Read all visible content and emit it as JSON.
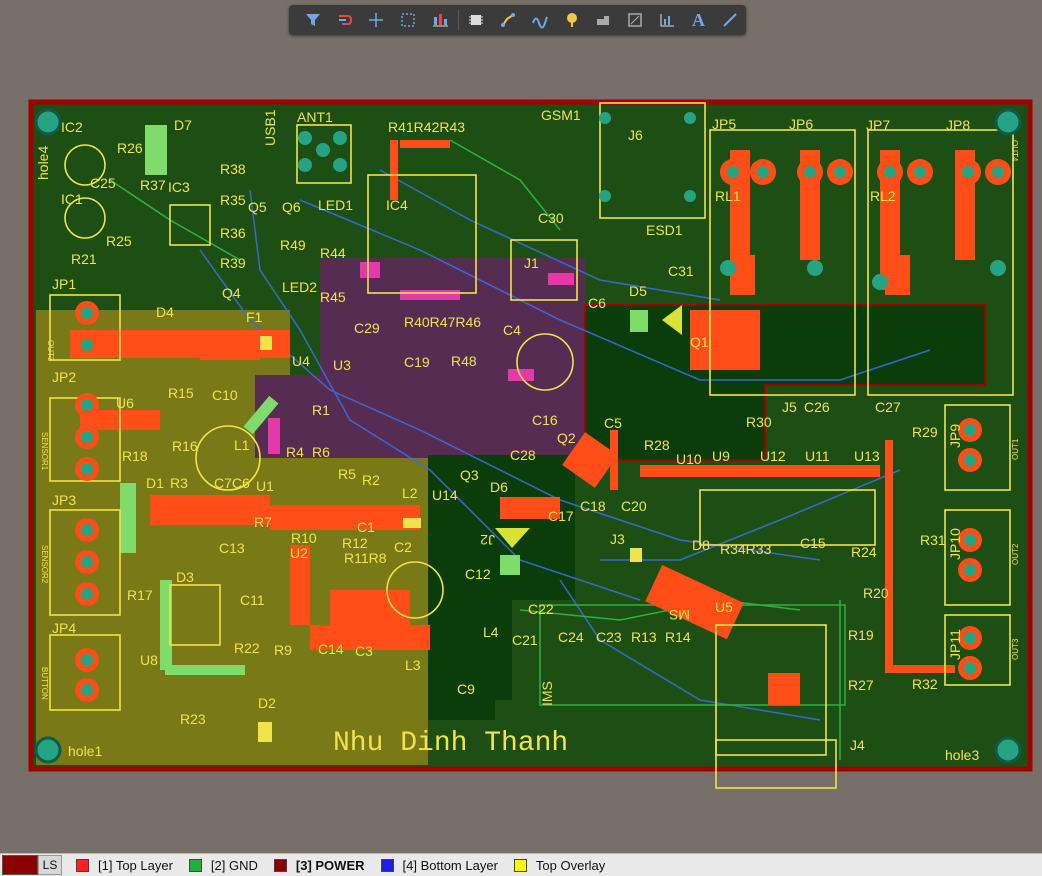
{
  "toolbar": {
    "icons": [
      "filter-icon",
      "route-icon",
      "crosshair-icon",
      "select-rect-icon",
      "align-icon",
      "component-icon",
      "interactive-route-icon",
      "diff-pair-icon",
      "via-icon",
      "polygon-icon",
      "region-icon",
      "dimension-icon",
      "text-icon",
      "line-icon"
    ],
    "text_tool_label": "A"
  },
  "board": {
    "signature": "Nhu Dinh Thanh",
    "holes": [
      "hole1",
      "hole3",
      "hole4"
    ],
    "components": [
      "IC2",
      "R26",
      "C25",
      "R37",
      "IC3",
      "IC1",
      "R25",
      "R21",
      "D7",
      "R38",
      "R35",
      "R36",
      "R39",
      "Q4",
      "USB1",
      "Q5",
      "Q6",
      "R49",
      "ANT1",
      "LED1",
      "IC4",
      "R41",
      "R42",
      "R43",
      "GSM1",
      "J6",
      "C30",
      "ESD1",
      "C31",
      "J1",
      "R44",
      "R45",
      "LED2",
      "C29",
      "R40",
      "R47",
      "R46",
      "C19",
      "R48",
      "C4",
      "F1",
      "D4",
      "U4",
      "U3",
      "R1",
      "JP1",
      "JP2",
      "JP3",
      "JP4",
      "U6",
      "R15",
      "C10",
      "R16",
      "L1",
      "R18",
      "D1",
      "R3",
      "C7",
      "C6",
      "U1",
      "R4",
      "R6",
      "R5",
      "R2",
      "L2",
      "C1",
      "R7",
      "R10",
      "R12",
      "R11",
      "R8",
      "C2",
      "U2",
      "C13",
      "D3",
      "R17",
      "C11",
      "R22",
      "U8",
      "R9",
      "C14",
      "C3",
      "L3",
      "C9",
      "R23",
      "D2",
      "Q1",
      "D5",
      "C5",
      "Q2",
      "C16",
      "Q3",
      "C28",
      "D6",
      "U14",
      "J2",
      "C18",
      "C17",
      "C20",
      "J3",
      "C12",
      "R28",
      "U10",
      "U9",
      "U12",
      "U11",
      "U13",
      "R30",
      "J5",
      "C26",
      "C27",
      "R29",
      "R31",
      "R24",
      "R20",
      "R19",
      "R27",
      "J4",
      "R32",
      "D8",
      "R34",
      "R33",
      "C15",
      "U5",
      "MS",
      "C22",
      "C21",
      "C24",
      "C23",
      "R13",
      "R14",
      "L4",
      "JP5",
      "JP6",
      "JP7",
      "JP8",
      "RL1",
      "RL2",
      "JP9",
      "JP10",
      "JP11"
    ],
    "connector_labels": [
      "OUT3",
      "SENSOR1",
      "SENSOR2",
      "BUTTON",
      "OUT1",
      "OUT2",
      "OUT3",
      "OUT4"
    ]
  },
  "layers": {
    "ls_label": "LS",
    "tabs": [
      {
        "label": "[1] Top Layer",
        "color": "#ff2020",
        "active": false
      },
      {
        "label": "[2] GND",
        "color": "#1fb23a",
        "active": false
      },
      {
        "label": "[3] POWER",
        "color": "#8a0000",
        "active": true
      },
      {
        "label": "[4] Bottom Layer",
        "color": "#1a20e8",
        "active": false
      },
      {
        "label": "Top Overlay",
        "color": "#ffff00",
        "active": false
      }
    ]
  },
  "colors": {
    "background": "#767068",
    "board_ground": "#1d4f14",
    "board_outline": "#a00000",
    "top_copper": "#ff4e17",
    "overlay": "#f2e34a",
    "power_plane_yellow": "#7e7c17",
    "power_plane_purple": "#5b2a55",
    "power_plane_dark": "#0b3d0b"
  }
}
